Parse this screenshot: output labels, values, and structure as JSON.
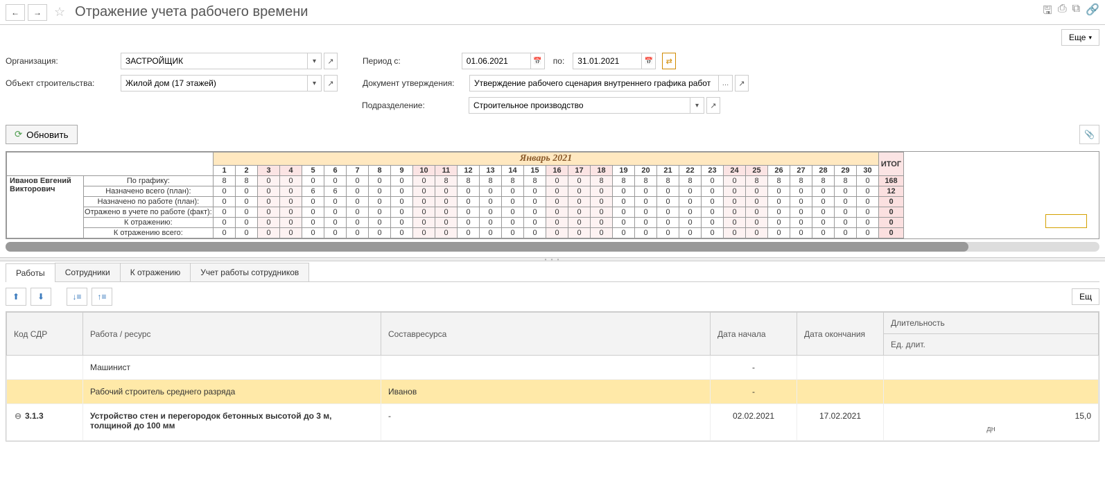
{
  "header": {
    "title": "Отражение учета рабочего времени",
    "more_btn": "Еще"
  },
  "filters": {
    "org_label": "Организация:",
    "org_value": "ЗАСТРОЙЩИК",
    "obj_label": "Объект строительства:",
    "obj_value": "Жилой дом (17 этажей)",
    "period_label": "Период с:",
    "period_from": "01.06.2021",
    "period_to_label": "по:",
    "period_to": "31.01.2021",
    "doc_label": "Документ утверждения:",
    "doc_value": "Утверждение рабочего сценария внутреннего графика работ",
    "dept_label": "Подразделение:",
    "dept_value": "Строительное производство",
    "refresh": "Обновить"
  },
  "timegrid": {
    "month": "Январь 2021",
    "days": [
      "1",
      "2",
      "3",
      "4",
      "5",
      "6",
      "7",
      "8",
      "9",
      "10",
      "11",
      "12",
      "13",
      "14",
      "15",
      "16",
      "17",
      "18",
      "19",
      "20",
      "21",
      "22",
      "23",
      "24",
      "25",
      "26",
      "27",
      "28",
      "29",
      "30"
    ],
    "weekend_idx": [
      2,
      3,
      9,
      10,
      15,
      16,
      17,
      23,
      24,
      30
    ],
    "itog_label": "ИТОГ",
    "employee_name": "Иванов Евгений Викторович",
    "rows": [
      {
        "label": "По графику:",
        "vals": [
          "8",
          "8",
          "0",
          "0",
          "0",
          "0",
          "0",
          "0",
          "0",
          "0",
          "8",
          "8",
          "8",
          "8",
          "8",
          "0",
          "0",
          "8",
          "8",
          "8",
          "8",
          "8",
          "0",
          "0",
          "8",
          "8",
          "8",
          "8",
          "8",
          "0"
        ],
        "itog": "168"
      },
      {
        "label": "Назначено всего (план):",
        "vals": [
          "0",
          "0",
          "0",
          "0",
          "6",
          "6",
          "0",
          "0",
          "0",
          "0",
          "0",
          "0",
          "0",
          "0",
          "0",
          "0",
          "0",
          "0",
          "0",
          "0",
          "0",
          "0",
          "0",
          "0",
          "0",
          "0",
          "0",
          "0",
          "0",
          "0"
        ],
        "itog": "12"
      },
      {
        "label": "Назначено по работе (план):",
        "vals": [
          "0",
          "0",
          "0",
          "0",
          "0",
          "0",
          "0",
          "0",
          "0",
          "0",
          "0",
          "0",
          "0",
          "0",
          "0",
          "0",
          "0",
          "0",
          "0",
          "0",
          "0",
          "0",
          "0",
          "0",
          "0",
          "0",
          "0",
          "0",
          "0",
          "0"
        ],
        "itog": "0"
      },
      {
        "label": "Отражено в учете по работе (факт):",
        "vals": [
          "0",
          "0",
          "0",
          "0",
          "0",
          "0",
          "0",
          "0",
          "0",
          "0",
          "0",
          "0",
          "0",
          "0",
          "0",
          "0",
          "0",
          "0",
          "0",
          "0",
          "0",
          "0",
          "0",
          "0",
          "0",
          "0",
          "0",
          "0",
          "0",
          "0"
        ],
        "itog": "0"
      },
      {
        "label": "К отражению:",
        "vals": [
          "0",
          "0",
          "0",
          "0",
          "0",
          "0",
          "0",
          "0",
          "0",
          "0",
          "0",
          "0",
          "0",
          "0",
          "0",
          "0",
          "0",
          "0",
          "0",
          "0",
          "0",
          "0",
          "0",
          "0",
          "0",
          "0",
          "0",
          "0",
          "0",
          "0"
        ],
        "itog": "0"
      },
      {
        "label": "К отражению всего:",
        "vals": [
          "0",
          "0",
          "0",
          "0",
          "0",
          "0",
          "0",
          "0",
          "0",
          "0",
          "0",
          "0",
          "0",
          "0",
          "0",
          "0",
          "0",
          "0",
          "0",
          "0",
          "0",
          "0",
          "0",
          "0",
          "0",
          "0",
          "0",
          "0",
          "0",
          "0"
        ],
        "itog": "0"
      }
    ]
  },
  "tabs": {
    "t1": "Работы",
    "t2": "Сотрудники",
    "t3": "К отражению",
    "t4": "Учет работы сотрудников",
    "more": "Ещ"
  },
  "btable": {
    "hdr_code": "Код СДР",
    "hdr_work": "Работа / ресурс",
    "hdr_res": "Составресурса",
    "hdr_d1": "Дата начала",
    "hdr_d2": "Дата окончания",
    "hdr_dur": "Длительность",
    "hdr_unit": "Ед. длит.",
    "rows": [
      {
        "code": "",
        "work": "Машинист",
        "res": "",
        "d1": "-",
        "d2": "",
        "dur": "",
        "hl": false
      },
      {
        "code": "",
        "work": "Рабочий строитель среднего разряда",
        "res": "Иванов",
        "d1": "-",
        "d2": "",
        "dur": "",
        "hl": true
      },
      {
        "code": "3.1.3",
        "work": "Устройство стен и перегородок бетонных высотой до 3 м, толщиной до 100 мм",
        "res": "-",
        "d1": "02.02.2021",
        "d2": "17.02.2021",
        "dur": "15,0",
        "unit": "дн",
        "hl": false,
        "bold": true,
        "expand": true
      }
    ]
  }
}
